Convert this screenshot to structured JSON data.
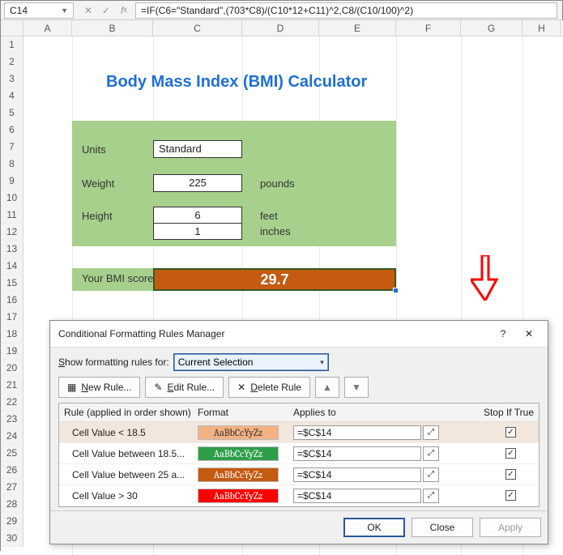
{
  "formula_bar": {
    "cell_ref": "C14",
    "formula": "=IF(C6=\"Standard\",(703*C8)/(C10*12+C11)^2,C8/(C10/100)^2)"
  },
  "columns": [
    "A",
    "B",
    "C",
    "D",
    "E",
    "F",
    "G",
    "H"
  ],
  "rows_visible": 30,
  "sheet": {
    "title": "Body Mass Index (BMI) Calculator",
    "units_label": "Units",
    "units_value": "Standard",
    "weight_label": "Weight",
    "weight_value": "225",
    "weight_unit": "pounds",
    "height_label": "Height",
    "height_ft": "6",
    "height_ft_unit": "feet",
    "height_in": "1",
    "height_in_unit": "inches",
    "score_label": "Your BMI score:",
    "score_value": "29.7"
  },
  "dialog": {
    "title": "Conditional Formatting Rules Manager",
    "show_label": "Show formatting rules for:",
    "show_value": "Current Selection",
    "new_rule": "New Rule...",
    "edit_rule": "Edit Rule...",
    "delete_rule": "Delete Rule",
    "head_rule": "Rule (applied in order shown)",
    "head_format": "Format",
    "head_applies": "Applies to",
    "head_stop": "Stop If True",
    "format_sample": "AaBbCcYyZz",
    "rules": [
      {
        "desc": "Cell Value < 18.5",
        "bg": "#f4b183",
        "fg": "#333",
        "ref": "=$C$14",
        "stop": true,
        "selected": true
      },
      {
        "desc": "Cell Value between 18.5...",
        "bg": "#2e9e49",
        "fg": "#fff",
        "ref": "=$C$14",
        "stop": true,
        "selected": false
      },
      {
        "desc": "Cell Value between 25 a...",
        "bg": "#c55a11",
        "fg": "#fff",
        "ref": "=$C$14",
        "stop": true,
        "selected": false
      },
      {
        "desc": "Cell Value > 30",
        "bg": "#ff0000",
        "fg": "#fff",
        "ref": "=$C$14",
        "stop": true,
        "selected": false
      }
    ],
    "ok": "OK",
    "close": "Close",
    "apply": "Apply"
  }
}
